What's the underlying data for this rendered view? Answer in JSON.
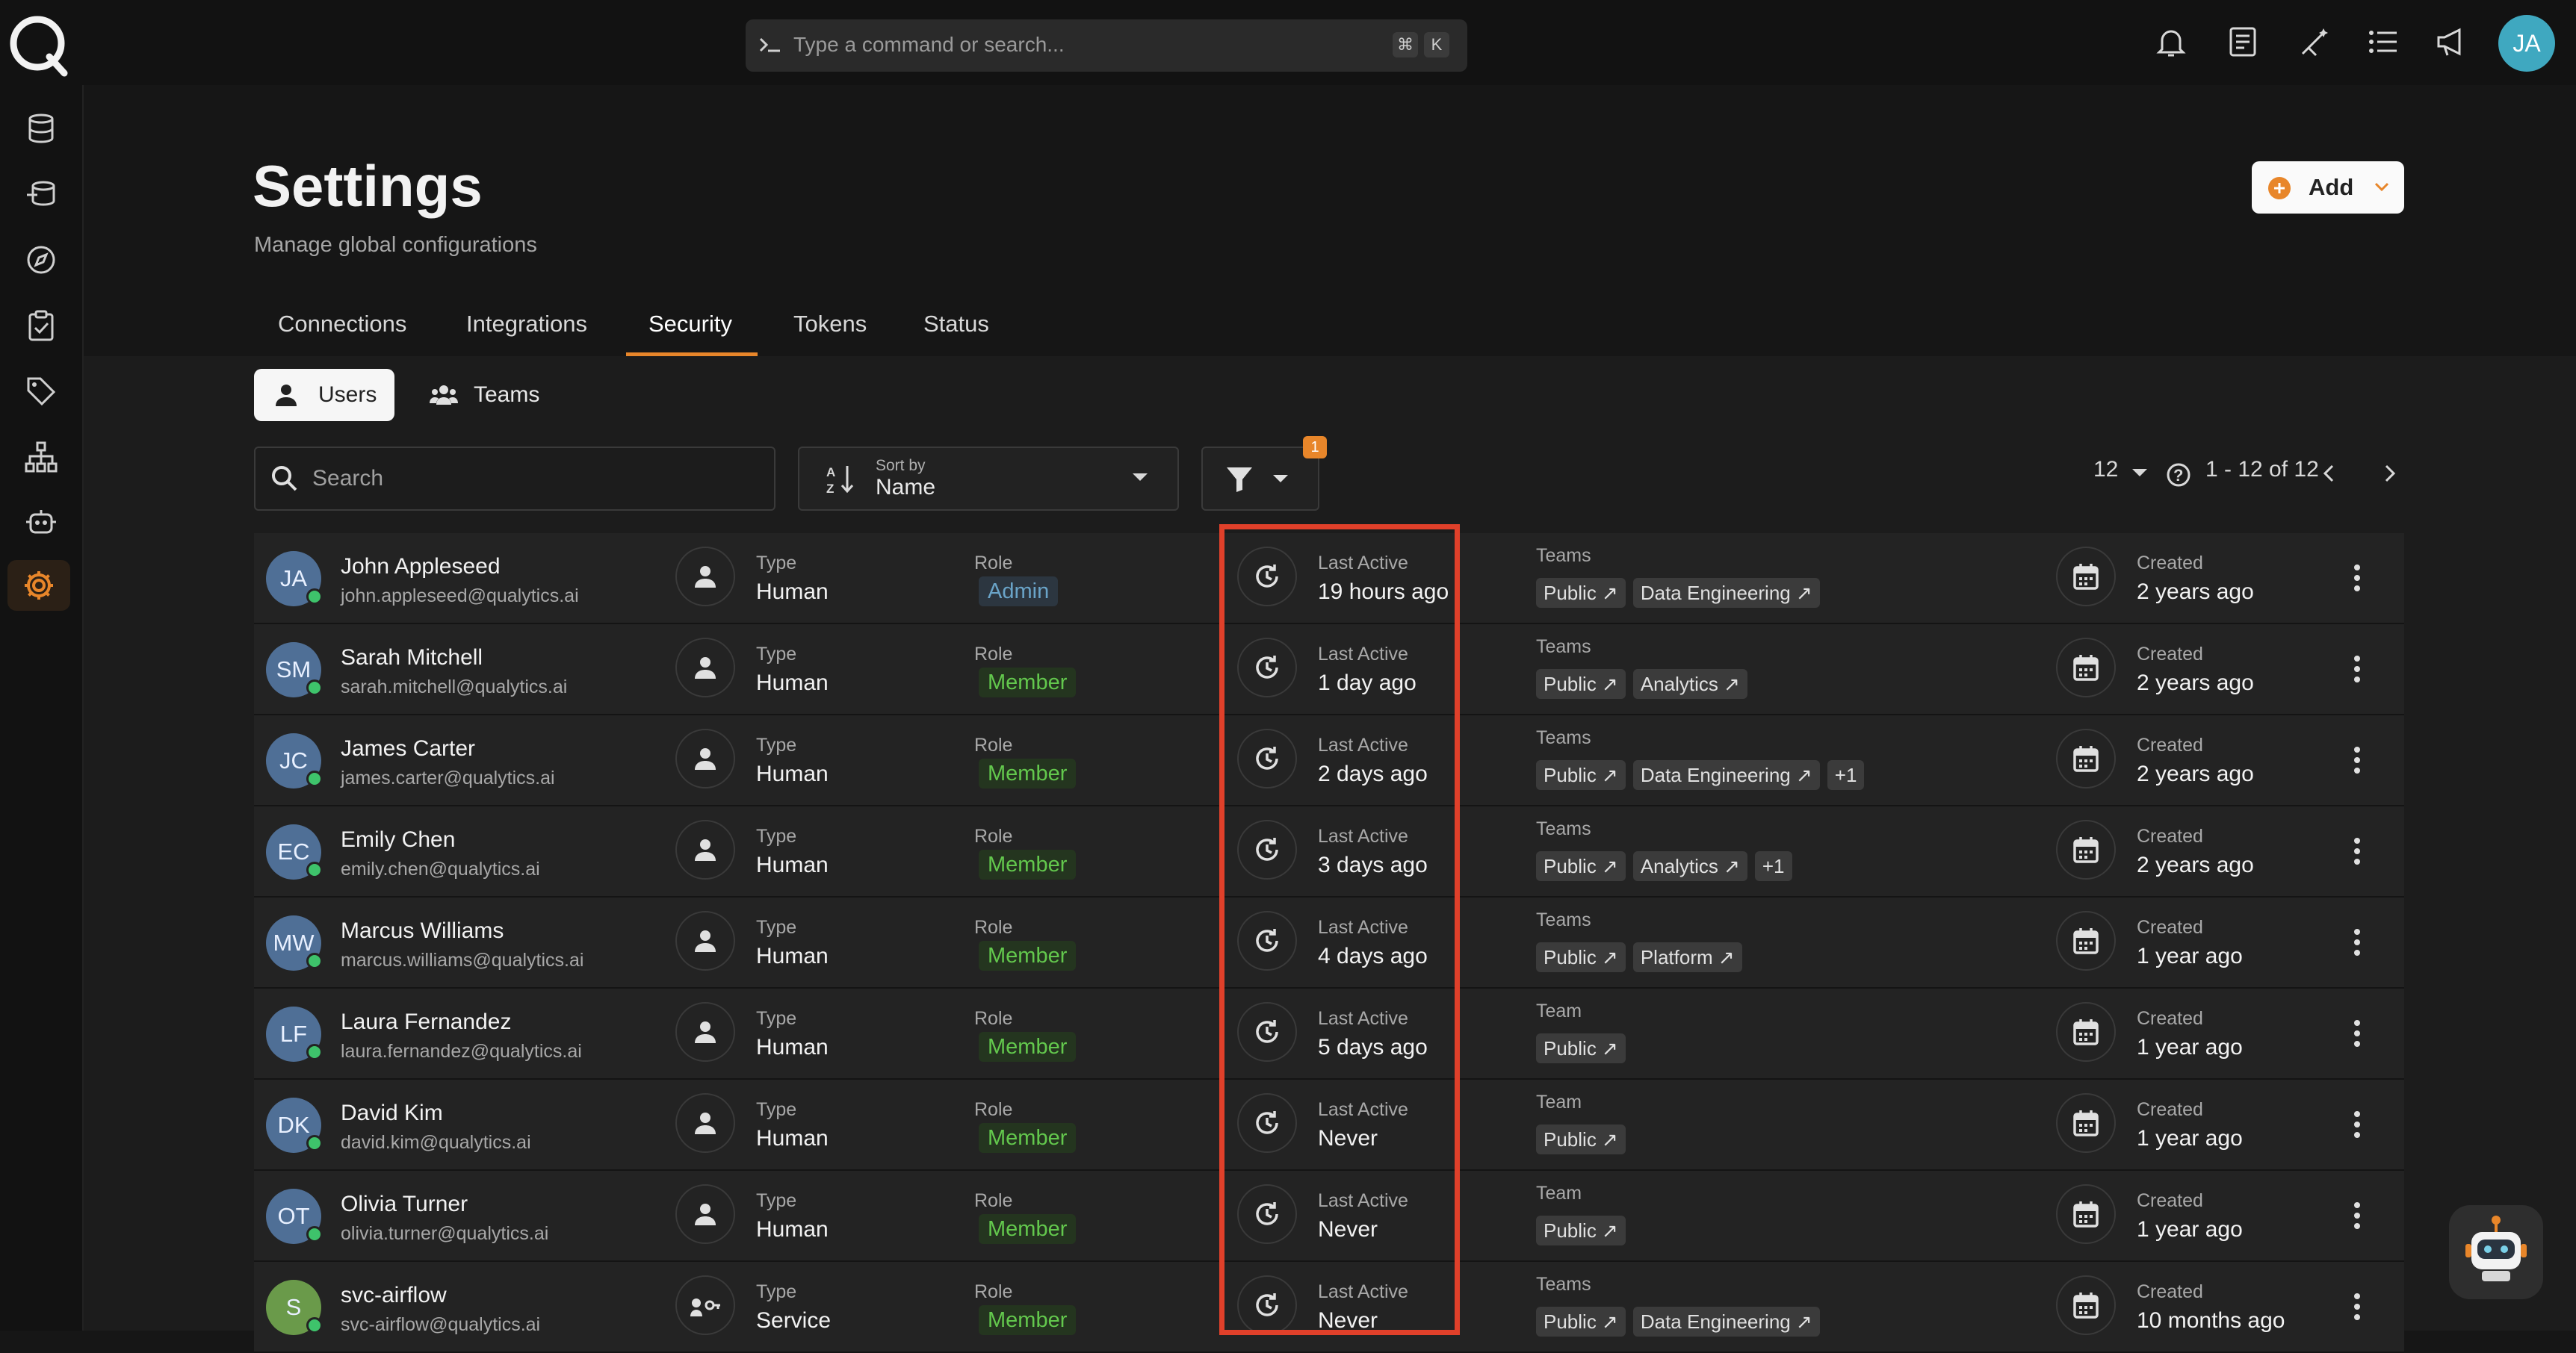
{
  "command_bar": {
    "placeholder": "Type a command or search...",
    "key1": "⌘",
    "key2": "K"
  },
  "user_avatar": "JA",
  "header": {
    "title": "Settings",
    "subtitle": "Manage global configurations",
    "add_label": "Add"
  },
  "tabs": [
    "Connections",
    "Integrations",
    "Security",
    "Tokens",
    "Status"
  ],
  "active_tab": "Security",
  "segments": {
    "users": "Users",
    "teams": "Teams"
  },
  "toolbar": {
    "search_placeholder": "Search",
    "sort_caption": "Sort by",
    "sort_value": "Name",
    "filter_count": "1",
    "page_size": "12",
    "range": "1 - 12 of 12"
  },
  "labels": {
    "type": "Type",
    "role": "Role",
    "last_active": "Last Active",
    "created": "Created"
  },
  "colors": {
    "accent": "#e8862a",
    "highlight": "#e0402a",
    "member": "#63c84d",
    "admin": "#6aa4c8"
  },
  "users": [
    {
      "initials": "JA",
      "avatar_color": "#4f6f96",
      "name": "John Appleseed",
      "email": "john.appleseed@qualytics.ai",
      "type": "Human",
      "role": "Admin",
      "last_active": "19 hours ago",
      "teams_label": "Teams",
      "teams": [
        "Public ↗",
        "Data Engineering ↗"
      ],
      "created": "2 years ago"
    },
    {
      "initials": "SM",
      "avatar_color": "#4f6f96",
      "name": "Sarah Mitchell",
      "email": "sarah.mitchell@qualytics.ai",
      "type": "Human",
      "role": "Member",
      "last_active": "1 day ago",
      "teams_label": "Teams",
      "teams": [
        "Public ↗",
        "Analytics ↗"
      ],
      "created": "2 years ago"
    },
    {
      "initials": "JC",
      "avatar_color": "#4f6f96",
      "name": "James Carter",
      "email": "james.carter@qualytics.ai",
      "type": "Human",
      "role": "Member",
      "last_active": "2 days ago",
      "teams_label": "Teams",
      "teams": [
        "Public ↗",
        "Data Engineering ↗",
        "+1"
      ],
      "created": "2 years ago"
    },
    {
      "initials": "EC",
      "avatar_color": "#4f6f96",
      "name": "Emily Chen",
      "email": "emily.chen@qualytics.ai",
      "type": "Human",
      "role": "Member",
      "last_active": "3 days ago",
      "teams_label": "Teams",
      "teams": [
        "Public ↗",
        "Analytics ↗",
        "+1"
      ],
      "created": "2 years ago"
    },
    {
      "initials": "MW",
      "avatar_color": "#4f6f96",
      "name": "Marcus Williams",
      "email": "marcus.williams@qualytics.ai",
      "type": "Human",
      "role": "Member",
      "last_active": "4 days ago",
      "teams_label": "Teams",
      "teams": [
        "Public ↗",
        "Platform ↗"
      ],
      "created": "1 year ago"
    },
    {
      "initials": "LF",
      "avatar_color": "#4f6f96",
      "name": "Laura Fernandez",
      "email": "laura.fernandez@qualytics.ai",
      "type": "Human",
      "role": "Member",
      "last_active": "5 days ago",
      "teams_label": "Team",
      "teams": [
        "Public ↗"
      ],
      "created": "1 year ago"
    },
    {
      "initials": "DK",
      "avatar_color": "#4f6f96",
      "name": "David Kim",
      "email": "david.kim@qualytics.ai",
      "type": "Human",
      "role": "Member",
      "last_active": "Never",
      "teams_label": "Team",
      "teams": [
        "Public ↗"
      ],
      "created": "1 year ago"
    },
    {
      "initials": "OT",
      "avatar_color": "#4f6f96",
      "name": "Olivia Turner",
      "email": "olivia.turner@qualytics.ai",
      "type": "Human",
      "role": "Member",
      "last_active": "Never",
      "teams_label": "Team",
      "teams": [
        "Public ↗"
      ],
      "created": "1 year ago"
    },
    {
      "initials": "S",
      "avatar_color": "#6a9a4a",
      "name": "svc-airflow",
      "email": "svc-airflow@qualytics.ai",
      "type": "Service",
      "role": "Member",
      "last_active": "Never",
      "teams_label": "Teams",
      "teams": [
        "Public ↗",
        "Data Engineering ↗"
      ],
      "created": "10 months ago"
    }
  ],
  "icons": {
    "sidebar": [
      "database-icon",
      "data-flow-icon",
      "compass-icon",
      "checklist-icon",
      "tag-icon",
      "hierarchy-icon",
      "robot-icon",
      "gear-icon"
    ],
    "top": [
      "bell-icon",
      "document-icon",
      "magic-wand-icon",
      "list-icon",
      "megaphone-icon"
    ]
  }
}
